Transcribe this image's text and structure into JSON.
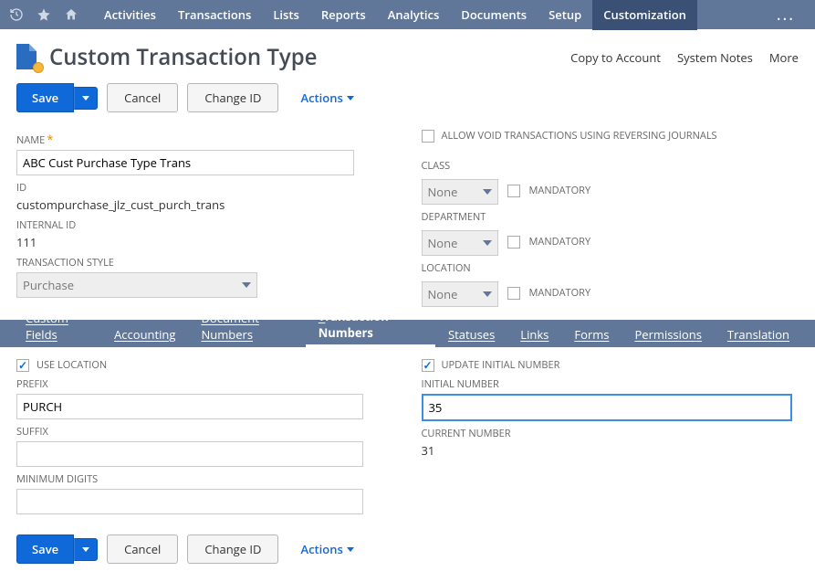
{
  "nav": {
    "items": [
      "Activities",
      "Transactions",
      "Lists",
      "Reports",
      "Analytics",
      "Documents",
      "Setup",
      "Customization"
    ],
    "activeIndex": 7
  },
  "header": {
    "title": "Custom Transaction Type",
    "links": [
      "Copy to Account",
      "System Notes",
      "More"
    ]
  },
  "buttons": {
    "save": "Save",
    "cancel": "Cancel",
    "changeId": "Change ID",
    "actions": "Actions"
  },
  "fields": {
    "name_label": "NAME",
    "name_value": "ABC Cust Purchase Type Trans",
    "id_label": "ID",
    "id_value": "custompurchase_jlz_cust_purch_trans",
    "internal_id_label": "INTERNAL ID",
    "internal_id_value": "111",
    "style_label": "TRANSACTION STYLE",
    "style_value": "Purchase",
    "allow_void_label": "ALLOW VOID TRANSACTIONS USING REVERSING JOURNALS",
    "class_label": "CLASS",
    "department_label": "DEPARTMENT",
    "location_label": "LOCATION",
    "none": "None",
    "mandatory": "MANDATORY"
  },
  "subtabs": [
    "Custom Fields",
    "Accounting",
    "Document Numbers",
    "Transaction Numbers",
    "Statuses",
    "Links",
    "Forms",
    "Permissions",
    "Translation"
  ],
  "subtabActive": 3,
  "txnNumbers": {
    "use_location_label": "USE LOCATION",
    "prefix_label": "PREFIX",
    "prefix_value": "PURCH",
    "suffix_label": "SUFFIX",
    "suffix_value": "",
    "min_digits_label": "MINIMUM DIGITS",
    "min_digits_value": "",
    "update_initial_label": "UPDATE INITIAL NUMBER",
    "initial_number_label": "INITIAL NUMBER",
    "initial_number_value": "35",
    "current_number_label": "CURRENT NUMBER",
    "current_number_value": "31"
  }
}
